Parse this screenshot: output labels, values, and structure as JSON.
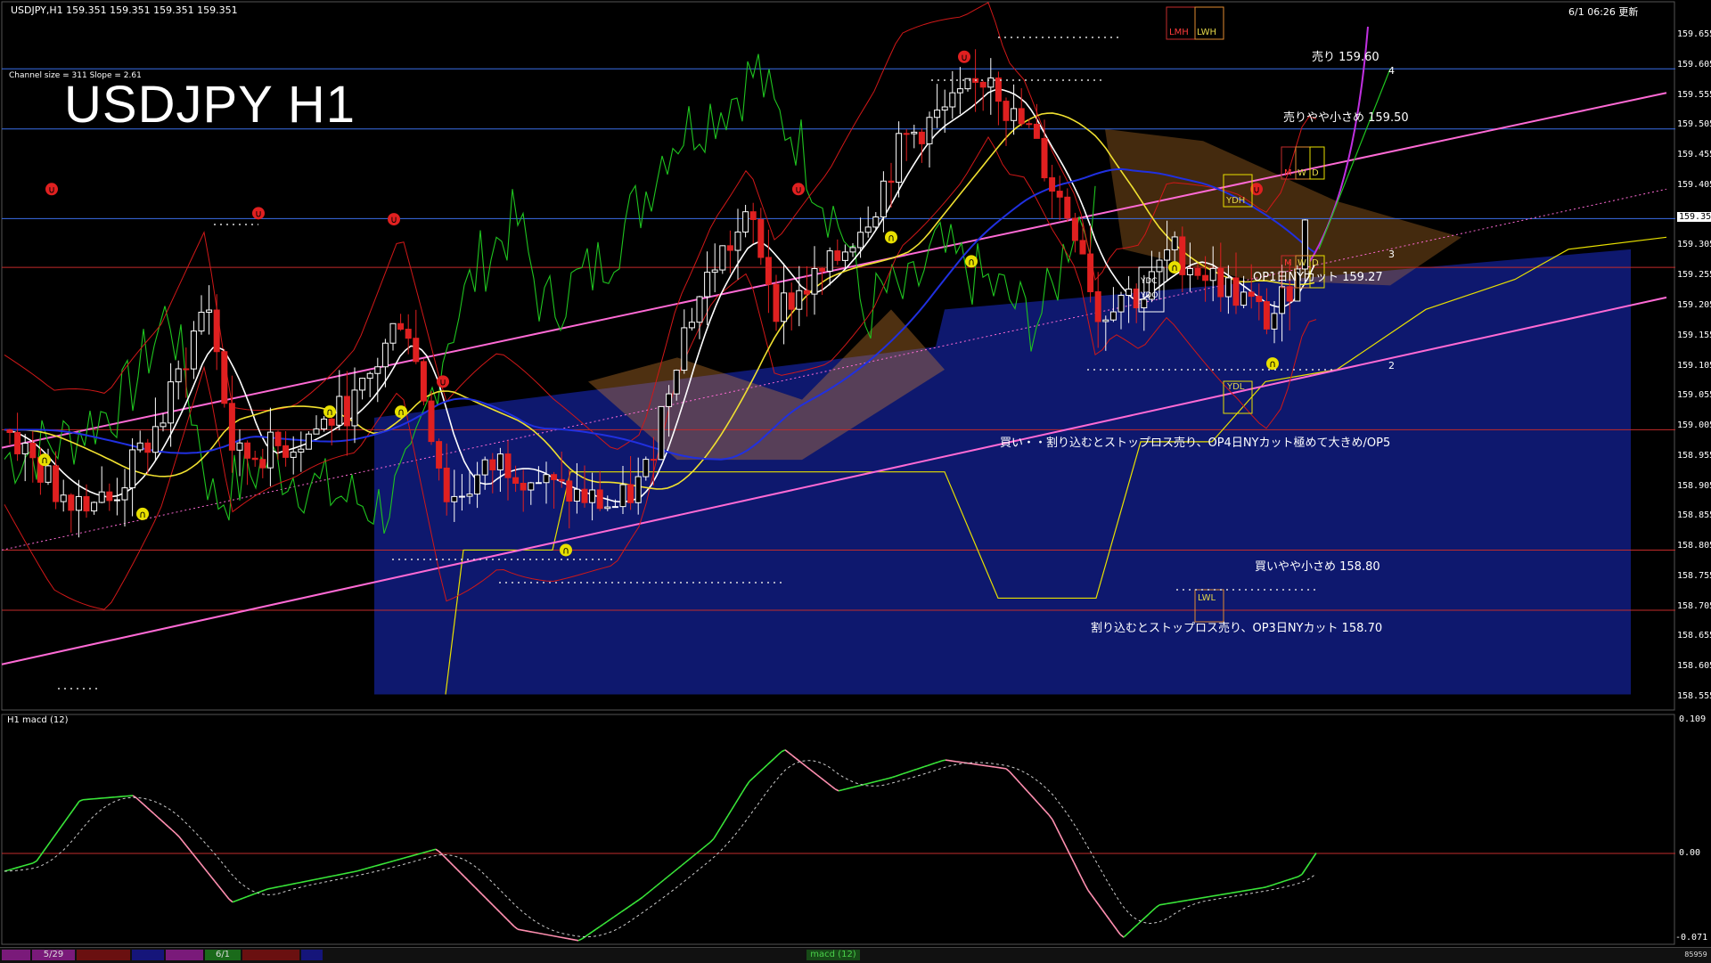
{
  "window": {
    "symbol_header": "USDJPY,H1  159.351 159.351 159.351 159.351",
    "timestamp": "6/1 06:26 更新",
    "title": "USDJPY H1",
    "channel_info": "Channel size = 311 Slope = 2.61"
  },
  "levels": [
    {
      "label": "売り 159.60",
      "price": 159.6,
      "color": "#3b6ee8"
    },
    {
      "label": "売りやや小さめ 159.50",
      "price": 159.5,
      "color": "#3b6ee8"
    },
    {
      "label": "OP1日NYカット 159.27",
      "price": 159.27,
      "color": "#c22b2b"
    },
    {
      "label": "買い・・割り込むとストップロス売り、OP4日NYカット極めて大きめ/OP5",
      "price": 159.0,
      "color": "#c22b2b"
    },
    {
      "label": "買いやや小さめ 158.80",
      "price": 158.8,
      "color": "#c22b2b"
    },
    {
      "label": "割り込むとストップロス売り、OP3日NYカット 158.70",
      "price": 158.7,
      "color": "#c22b2b"
    }
  ],
  "price_axis": {
    "ticks": [
      "159.655",
      "159.605",
      "159.555",
      "159.505",
      "159.455",
      "159.405",
      "159.351",
      "159.305",
      "159.255",
      "159.205",
      "159.155",
      "159.105",
      "159.055",
      "159.005",
      "158.955",
      "158.905",
      "158.855",
      "158.805",
      "158.755",
      "158.705",
      "158.655",
      "158.605",
      "158.555"
    ],
    "current_price": "159.351",
    "range": [
      158.54,
      159.67
    ]
  },
  "macd": {
    "label": "H1  macd (12)",
    "axis_ticks": [
      "0.109",
      "0.00",
      "-0.071"
    ]
  },
  "box_labels": {
    "lmh": "LMH",
    "lwh": "LWH",
    "ydh": "YDH",
    "ydc": "YDC",
    "ydo": "YDO",
    "ydl": "YDL",
    "lwl": "LWL",
    "m": "M",
    "w": "W",
    "d": "D"
  },
  "channel_markers": [
    "4",
    "3",
    "2"
  ],
  "status_bar": {
    "dates": [
      "5/29",
      "6/1"
    ],
    "macd_tab": "macd (12)",
    "right_value": "85959"
  },
  "colors": {
    "background": "#000000",
    "bull_candle": "#ffffff",
    "bear_candle": "#e02020",
    "ma_white": "#ffffff",
    "ma_yellow": "#f0e030",
    "ma_blue": "#2030e0",
    "bollinger": "#d01818",
    "chikou": "#1fc41f",
    "channel": "#ff6ad5",
    "macd_up": "#39e639",
    "macd_down": "#ff8fb0",
    "signal": "#cccccc",
    "cloud_blue": "#1a2cc8",
    "cloud_orange": "#e08a30",
    "kijun": "#e8e000"
  }
}
